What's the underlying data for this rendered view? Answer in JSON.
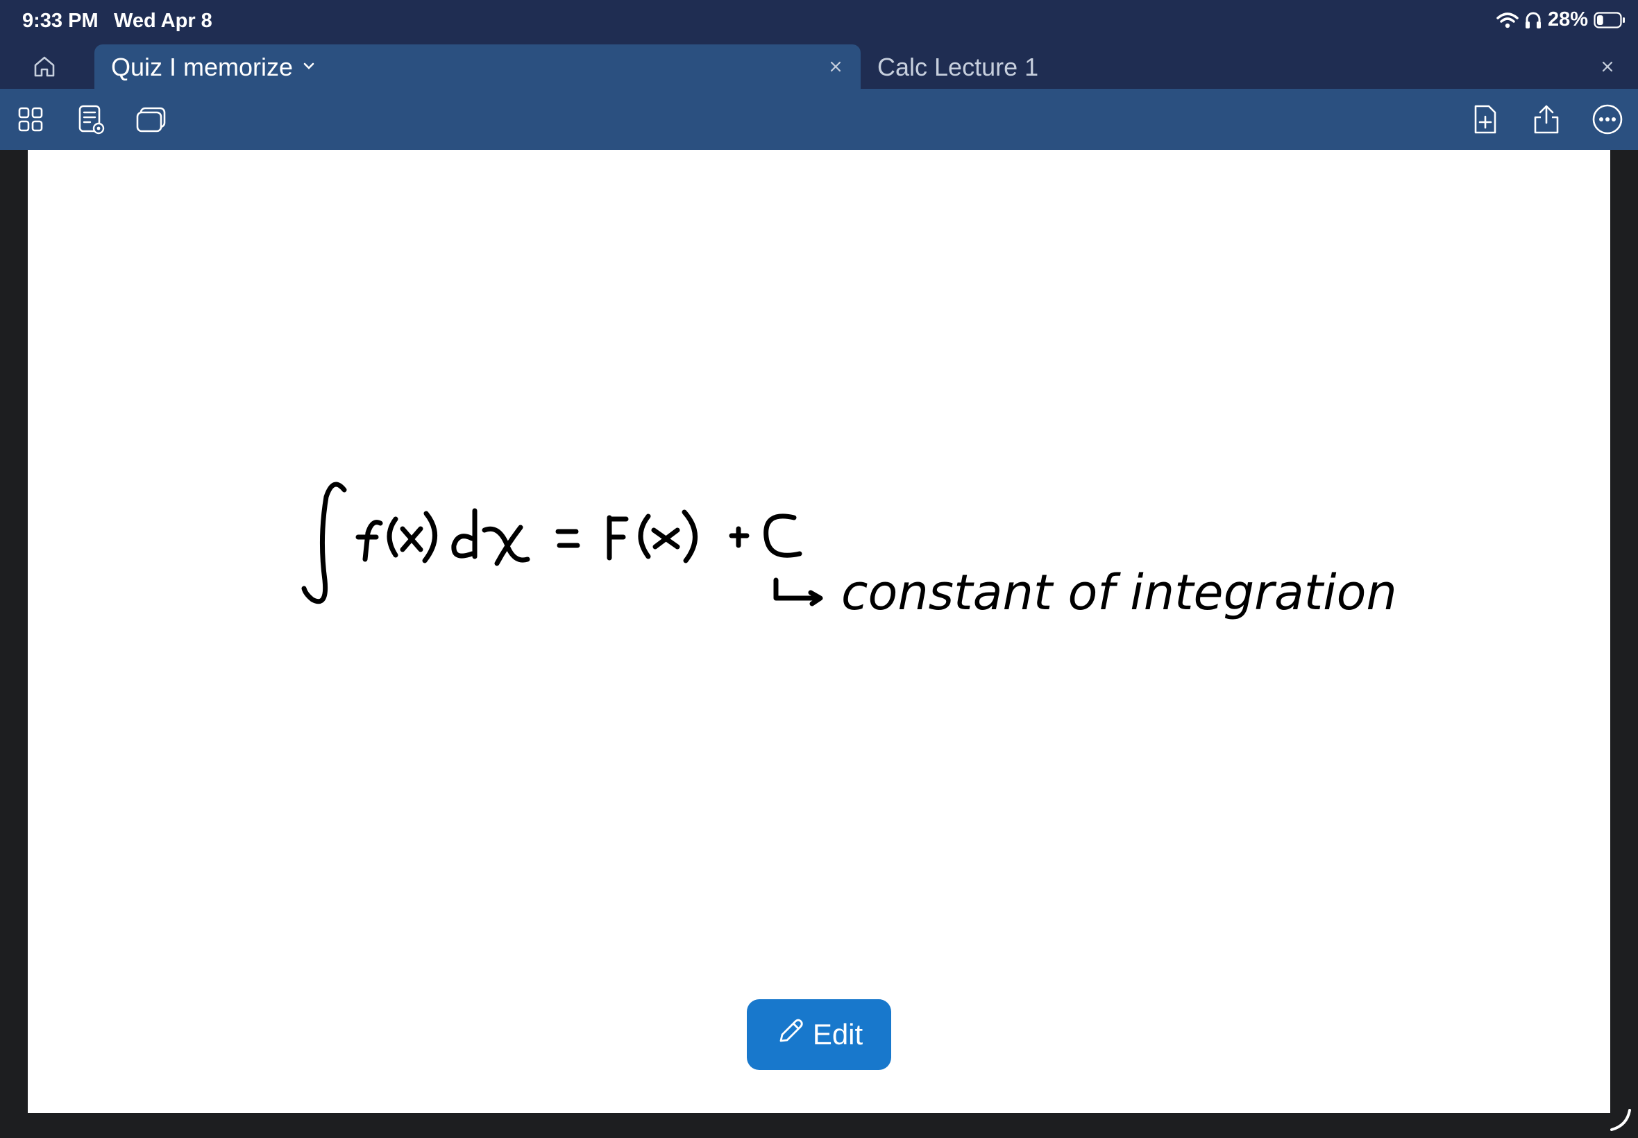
{
  "status_bar": {
    "time": "9:33 PM",
    "date": "Wed Apr 8",
    "battery_percent": "28%",
    "battery_level": 0.28,
    "icons": [
      "wifi-icon",
      "headphones-icon",
      "battery-icon"
    ]
  },
  "tabs": [
    {
      "label": "Quiz I memorize",
      "active": true
    },
    {
      "label": "Calc Lecture 1",
      "active": false
    }
  ],
  "toolbar": {
    "left_icons": [
      "grid-view-icon",
      "notes-view-icon",
      "pages-icon"
    ],
    "right_icons": [
      "add-page-icon",
      "share-icon",
      "more-icon"
    ]
  },
  "note": {
    "handwritten_equation": "∫f(x) dx = F(x) + C",
    "handwritten_annotation": "constant of integration"
  },
  "edit_button": {
    "label": "Edit",
    "icon": "pencil-icon"
  },
  "colors": {
    "status_bg": "#1f2d52",
    "toolbar_bg": "#2b5080",
    "accent": "#1878cc",
    "ink": "#000000"
  }
}
